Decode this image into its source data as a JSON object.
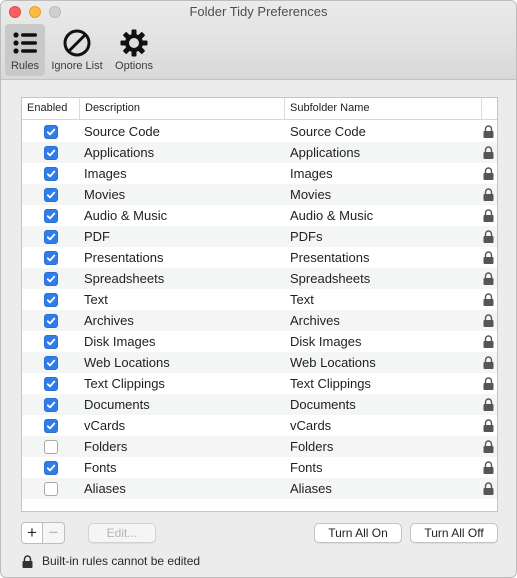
{
  "window": {
    "title": "Folder Tidy Preferences"
  },
  "toolbar": {
    "rules_label": "Rules",
    "ignore_label": "Ignore List",
    "options_label": "Options"
  },
  "table": {
    "headers": {
      "enabled": "Enabled",
      "description": "Description",
      "subfolder": "Subfolder Name"
    },
    "rows": [
      {
        "enabled": true,
        "description": "Source Code",
        "subfolder": "Source Code"
      },
      {
        "enabled": true,
        "description": "Applications",
        "subfolder": "Applications"
      },
      {
        "enabled": true,
        "description": "Images",
        "subfolder": "Images"
      },
      {
        "enabled": true,
        "description": "Movies",
        "subfolder": "Movies"
      },
      {
        "enabled": true,
        "description": "Audio & Music",
        "subfolder": "Audio & Music"
      },
      {
        "enabled": true,
        "description": "PDF",
        "subfolder": "PDFs"
      },
      {
        "enabled": true,
        "description": "Presentations",
        "subfolder": "Presentations"
      },
      {
        "enabled": true,
        "description": "Spreadsheets",
        "subfolder": "Spreadsheets"
      },
      {
        "enabled": true,
        "description": "Text",
        "subfolder": "Text"
      },
      {
        "enabled": true,
        "description": "Archives",
        "subfolder": "Archives"
      },
      {
        "enabled": true,
        "description": "Disk Images",
        "subfolder": "Disk Images"
      },
      {
        "enabled": true,
        "description": "Web Locations",
        "subfolder": "Web Locations"
      },
      {
        "enabled": true,
        "description": "Text Clippings",
        "subfolder": "Text Clippings"
      },
      {
        "enabled": true,
        "description": "Documents",
        "subfolder": "Documents"
      },
      {
        "enabled": true,
        "description": "vCards",
        "subfolder": "vCards"
      },
      {
        "enabled": false,
        "description": "Folders",
        "subfolder": "Folders"
      },
      {
        "enabled": true,
        "description": "Fonts",
        "subfolder": "Fonts"
      },
      {
        "enabled": false,
        "description": "Aliases",
        "subfolder": "Aliases"
      }
    ]
  },
  "controls": {
    "add_label": "+",
    "remove_label": "−",
    "edit_label": "Edit...",
    "turn_all_on_label": "Turn All On",
    "turn_all_off_label": "Turn All Off"
  },
  "footer": {
    "note": "Built-in rules cannot be edited"
  },
  "colors": {
    "checkbox_on": "#2f7dea",
    "toolbar_selected": "#c9c9c9"
  }
}
